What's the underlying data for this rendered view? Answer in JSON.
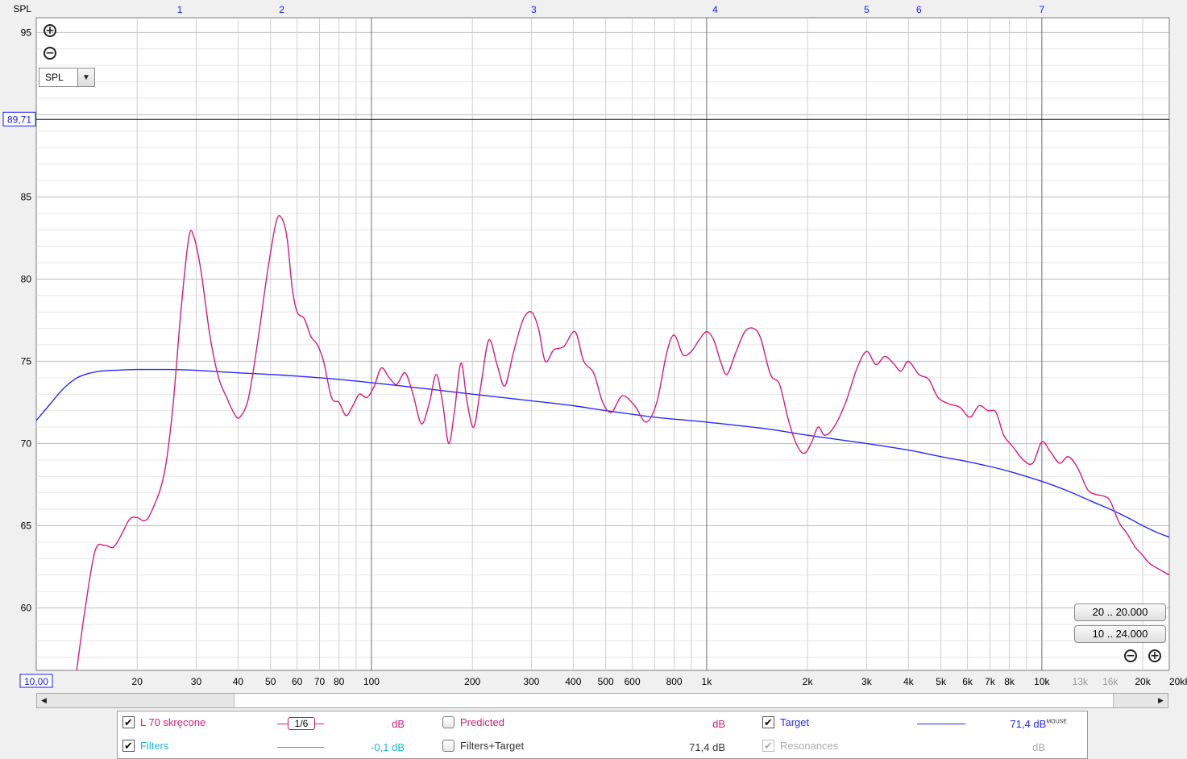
{
  "chart_data": {
    "type": "line",
    "ylabel": "SPL",
    "x_unit": "kHz",
    "x_scale": "log",
    "xlim": [
      10,
      24000
    ],
    "ylim": [
      56.2,
      95.9
    ],
    "y_ticks": [
      60,
      65,
      70,
      75,
      80,
      85,
      90,
      95
    ],
    "y_tick_labels": [
      "60",
      "65",
      "70",
      "75",
      "80",
      "85",
      "",
      "95"
    ],
    "x_ticks": [
      20,
      30,
      40,
      50,
      60,
      70,
      80,
      100,
      200,
      300,
      400,
      500,
      600,
      800,
      1000,
      2000,
      3000,
      4000,
      5000,
      6000,
      7000,
      8000,
      10000,
      13000,
      16000,
      20000
    ],
    "x_tick_labels": [
      "20",
      "30",
      "40",
      "50",
      "60",
      "70",
      "80",
      "100",
      "200",
      "300",
      "400",
      "500",
      "600",
      "800",
      "1k",
      "2k",
      "3k",
      "4k",
      "5k",
      "6k",
      "7k",
      "8k",
      "10k",
      "13k",
      "16k",
      "20k"
    ],
    "x_tick_labels_dim": [
      "13k",
      "16k"
    ],
    "x_start_label": "10,00",
    "x_end_label": "20kHz",
    "cursor_y": 89.71,
    "cursor_y_label": "89,71",
    "markers": [
      {
        "label": "1",
        "x": 26.8
      },
      {
        "label": "2",
        "x": 54
      },
      {
        "label": "3",
        "x": 305
      },
      {
        "label": "4",
        "x": 1060
      },
      {
        "label": "5",
        "x": 3000
      },
      {
        "label": "6",
        "x": 4300
      },
      {
        "label": "7",
        "x": 10000
      }
    ],
    "grid": true,
    "series": [
      {
        "name": "L 70 skręcone",
        "color": "#d81b78",
        "points": [
          [
            13.2,
            56.2
          ],
          [
            14,
            60
          ],
          [
            15,
            63.5
          ],
          [
            16,
            63.8
          ],
          [
            17,
            63.7
          ],
          [
            18,
            64.5
          ],
          [
            19,
            65.4
          ],
          [
            20,
            65.5
          ],
          [
            21,
            65.3
          ],
          [
            22,
            65.8
          ],
          [
            24,
            68
          ],
          [
            25.5,
            72
          ],
          [
            27,
            78
          ],
          [
            28.5,
            82.5
          ],
          [
            29.5,
            82.6
          ],
          [
            31,
            80.5
          ],
          [
            33,
            76.5
          ],
          [
            35,
            74
          ],
          [
            37,
            72.8
          ],
          [
            39,
            71.8
          ],
          [
            40.5,
            71.6
          ],
          [
            43,
            72.8
          ],
          [
            46,
            76.5
          ],
          [
            49,
            80.5
          ],
          [
            52,
            83.5
          ],
          [
            54,
            83.7
          ],
          [
            56,
            82.5
          ],
          [
            58,
            79.5
          ],
          [
            60,
            78
          ],
          [
            63,
            77.6
          ],
          [
            66,
            76.5
          ],
          [
            69,
            76
          ],
          [
            72,
            75
          ],
          [
            76,
            72.8
          ],
          [
            80,
            72.5
          ],
          [
            84,
            71.7
          ],
          [
            88,
            72.3
          ],
          [
            92,
            73
          ],
          [
            97,
            72.8
          ],
          [
            102,
            73.5
          ],
          [
            107,
            74.6
          ],
          [
            113,
            74
          ],
          [
            119,
            73.6
          ],
          [
            126,
            74.3
          ],
          [
            133,
            73
          ],
          [
            141,
            71.2
          ],
          [
            149,
            72.5
          ],
          [
            156,
            74.2
          ],
          [
            163,
            72.5
          ],
          [
            170,
            70
          ],
          [
            177,
            72
          ],
          [
            185,
            74.9
          ],
          [
            193,
            72.5
          ],
          [
            202,
            71
          ],
          [
            212,
            73.5
          ],
          [
            224,
            76.3
          ],
          [
            237,
            74.8
          ],
          [
            250,
            73.5
          ],
          [
            265,
            75.5
          ],
          [
            283,
            77.5
          ],
          [
            300,
            78
          ],
          [
            315,
            77
          ],
          [
            330,
            75
          ],
          [
            350,
            75.7
          ],
          [
            375,
            75.9
          ],
          [
            405,
            76.8
          ],
          [
            430,
            75
          ],
          [
            460,
            74.3
          ],
          [
            490,
            72.5
          ],
          [
            520,
            71.9
          ],
          [
            560,
            72.9
          ],
          [
            610,
            72.3
          ],
          [
            660,
            71.3
          ],
          [
            710,
            72.5
          ],
          [
            760,
            75.5
          ],
          [
            800,
            76.6
          ],
          [
            850,
            75.4
          ],
          [
            900,
            75.6
          ],
          [
            950,
            76.3
          ],
          [
            1000,
            76.8
          ],
          [
            1050,
            76.3
          ],
          [
            1100,
            75
          ],
          [
            1150,
            74.2
          ],
          [
            1220,
            75.5
          ],
          [
            1300,
            76.8
          ],
          [
            1380,
            77
          ],
          [
            1450,
            76.4
          ],
          [
            1550,
            74.2
          ],
          [
            1650,
            73.6
          ],
          [
            1750,
            71.5
          ],
          [
            1850,
            70
          ],
          [
            1950,
            69.4
          ],
          [
            2050,
            70
          ],
          [
            2150,
            71
          ],
          [
            2250,
            70.5
          ],
          [
            2400,
            71
          ],
          [
            2600,
            72.5
          ],
          [
            2800,
            74.5
          ],
          [
            3000,
            75.6
          ],
          [
            3200,
            74.8
          ],
          [
            3400,
            75.3
          ],
          [
            3600,
            74.9
          ],
          [
            3800,
            74.4
          ],
          [
            4000,
            75
          ],
          [
            4300,
            74.2
          ],
          [
            4600,
            73.9
          ],
          [
            4900,
            72.8
          ],
          [
            5300,
            72.4
          ],
          [
            5700,
            72.2
          ],
          [
            6100,
            71.6
          ],
          [
            6500,
            72.3
          ],
          [
            6900,
            72
          ],
          [
            7300,
            71.9
          ],
          [
            7700,
            70.5
          ],
          [
            8200,
            69.8
          ],
          [
            8800,
            69
          ],
          [
            9400,
            68.8
          ],
          [
            10000,
            70.1
          ],
          [
            10600,
            69.5
          ],
          [
            11300,
            68.8
          ],
          [
            12000,
            69.2
          ],
          [
            12800,
            68.5
          ],
          [
            13700,
            67.2
          ],
          [
            14500,
            66.9
          ],
          [
            15300,
            66.8
          ],
          [
            16000,
            66.5
          ],
          [
            17000,
            65.2
          ],
          [
            18000,
            64.5
          ],
          [
            19000,
            63.7
          ],
          [
            20000,
            63.2
          ],
          [
            21000,
            62.7
          ],
          [
            24000,
            62
          ]
        ]
      },
      {
        "name": "Target",
        "color": "#2828ff",
        "points": [
          [
            10,
            71.4
          ],
          [
            11,
            72.4
          ],
          [
            12,
            73.3
          ],
          [
            13,
            73.9
          ],
          [
            14,
            74.2
          ],
          [
            15.5,
            74.4
          ],
          [
            17,
            74.45
          ],
          [
            20,
            74.5
          ],
          [
            25,
            74.5
          ],
          [
            30,
            74.45
          ],
          [
            40,
            74.3
          ],
          [
            50,
            74.2
          ],
          [
            60,
            74.1
          ],
          [
            80,
            73.9
          ],
          [
            100,
            73.7
          ],
          [
            150,
            73.3
          ],
          [
            200,
            73
          ],
          [
            300,
            72.6
          ],
          [
            400,
            72.3
          ],
          [
            500,
            72
          ],
          [
            700,
            71.6
          ],
          [
            1000,
            71.3
          ],
          [
            1500,
            70.9
          ],
          [
            2000,
            70.5
          ],
          [
            3000,
            70
          ],
          [
            4000,
            69.6
          ],
          [
            5000,
            69.2
          ],
          [
            6000,
            68.9
          ],
          [
            7000,
            68.6
          ],
          [
            8000,
            68.3
          ],
          [
            10000,
            67.7
          ],
          [
            12000,
            67.1
          ],
          [
            14000,
            66.5
          ],
          [
            16000,
            66
          ],
          [
            18000,
            65.5
          ],
          [
            20000,
            65
          ],
          [
            22000,
            64.6
          ],
          [
            24000,
            64.3
          ]
        ]
      }
    ]
  },
  "controls": {
    "spl_select_value": "SPL",
    "range_button_1": "20 .. 20.000",
    "range_button_2": "10 .. 24.000"
  },
  "legend": {
    "items": [
      {
        "label": "L 70 skręcone",
        "value": "dB",
        "checked": true,
        "color": "#d81b78",
        "smoothing": "1/6"
      },
      {
        "label": "Filters",
        "value": "-0,1 dB",
        "checked": true,
        "color": "#1ab8c8"
      },
      {
        "label": "Predicted",
        "value": "dB",
        "checked": false,
        "color": "#d81b78"
      },
      {
        "label": "Filters+Target",
        "value": "71,4 dB",
        "checked": false,
        "color": "#333333"
      },
      {
        "label": "Target",
        "value": "71,4 dB",
        "value_suffix": "MOUSE",
        "checked": true,
        "color": "#2828ff"
      },
      {
        "label": "Resonances",
        "value": "dB",
        "checked": true,
        "disabled": true,
        "color": "#aaaaaa"
      }
    ]
  }
}
